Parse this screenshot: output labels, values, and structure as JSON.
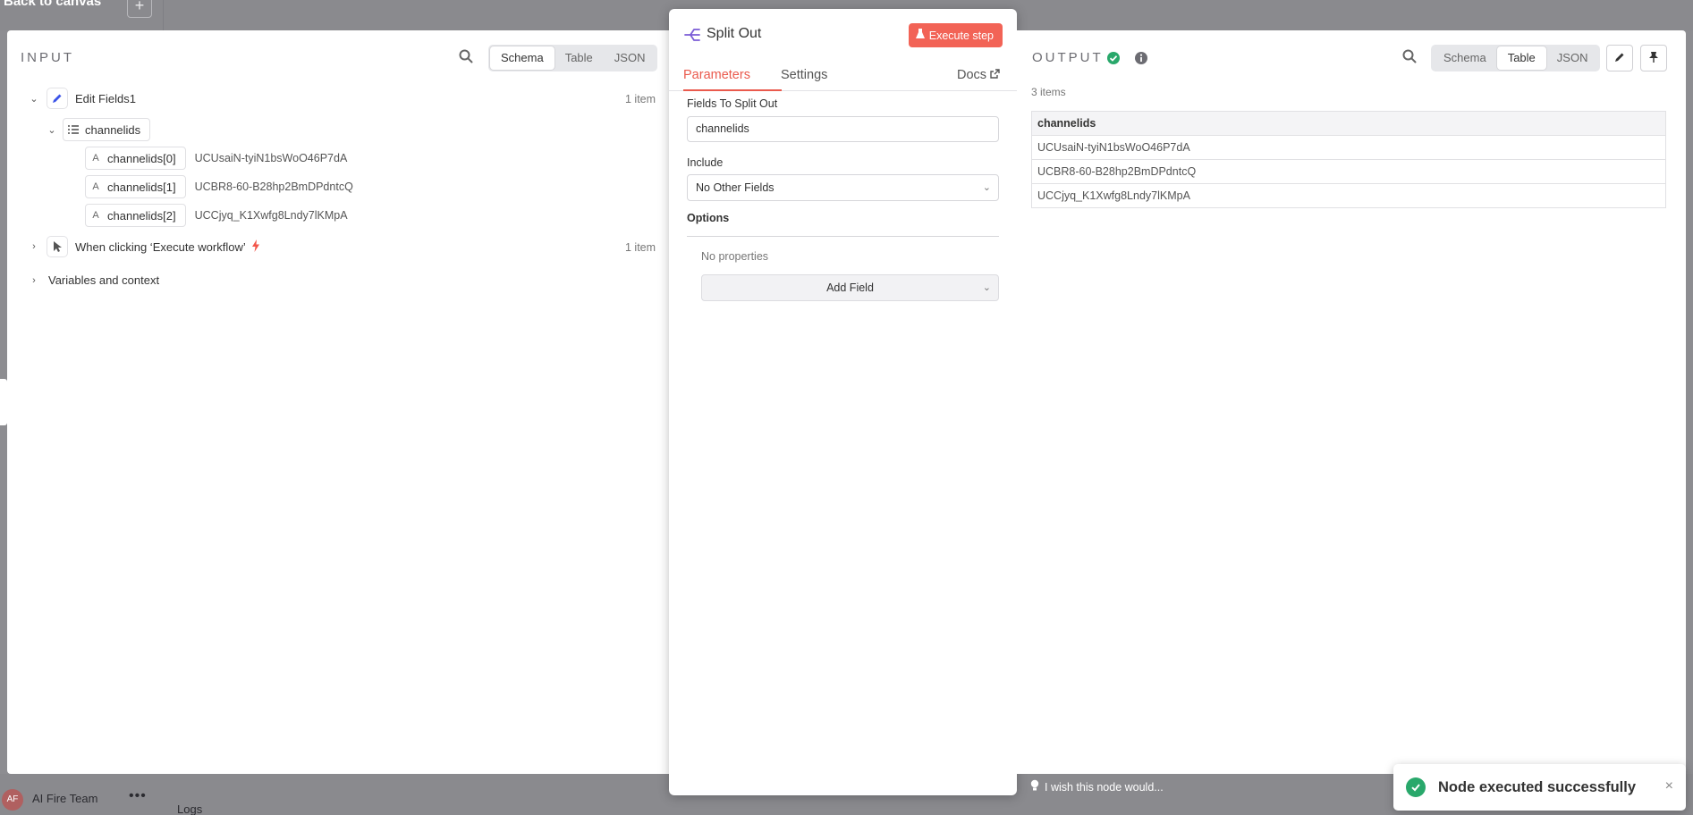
{
  "background": {
    "back_label": "Back to canvas",
    "plus": "+",
    "team_name": "AI Fire Team",
    "team_initials": "AF",
    "logs_label": "Logs",
    "more": "•••"
  },
  "input": {
    "title": "INPUT",
    "view_tabs": [
      "Schema",
      "Table",
      "JSON"
    ],
    "active_view": "Schema",
    "tree": {
      "node1": {
        "name": "Edit Fields1",
        "count": "1 item"
      },
      "field": {
        "name": "channelids"
      },
      "items": [
        {
          "key": "channelids[0]",
          "value": "UCUsaiN-tyiN1bsWoO46P7dA",
          "type_icon": "A"
        },
        {
          "key": "channelids[1]",
          "value": "UCBR8-60-B28hp2BmDPdntcQ",
          "type_icon": "A"
        },
        {
          "key": "channelids[2]",
          "value": "UCCjyq_K1Xwfg8Lndy7lKMpA",
          "type_icon": "A"
        }
      ],
      "node2": {
        "name": "When clicking ‘Execute workflow’",
        "count": "1 item"
      },
      "vars": {
        "name": "Variables and context"
      }
    }
  },
  "node": {
    "title": "Split Out",
    "execute_label": "Execute step",
    "tabs": [
      "Parameters",
      "Settings"
    ],
    "active_tab": "Parameters",
    "docs_label": "Docs",
    "fields_label": "Fields To Split Out",
    "fields_value": "channelids",
    "include_label": "Include",
    "include_value": "No Other Fields",
    "options_label": "Options",
    "no_properties": "No properties",
    "add_field_label": "Add Field"
  },
  "output": {
    "title": "OUTPUT",
    "view_tabs": [
      "Schema",
      "Table",
      "JSON"
    ],
    "active_view": "Table",
    "item_count": "3 items",
    "table": {
      "header": "channelids",
      "rows": [
        "UCUsaiN-tyiN1bsWoO46P7dA",
        "UCBR8-60-B28hp2BmDPdntcQ",
        "UCCjyq_K1Xwfg8Lndy7lKMpA"
      ]
    }
  },
  "footer": {
    "wish_label": "I wish this node would..."
  },
  "toast": {
    "message": "Node executed successfully",
    "close": "×"
  },
  "colors": {
    "accent": "#ea5a4d",
    "success": "#29a86b",
    "execute_button": "#f26356"
  }
}
